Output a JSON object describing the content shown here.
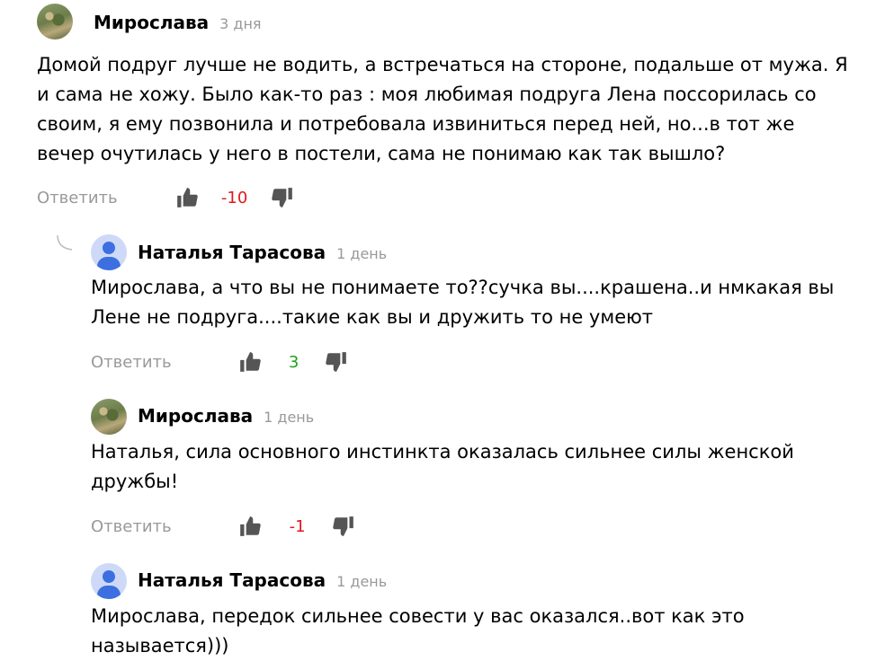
{
  "comments": [
    {
      "author": "Мирослава",
      "time": "3 дня",
      "text": "Домой подруг лучше не водить, а встречаться на стороне, подальше от мужа. Я и сама не хожу. Было как-то раз : моя любимая подруга Лена поссорилась со своим, я ему позвонила и потребовала извиниться перед ней, но...в тот же вечер очутилась у него в постели, сама не понимаю как так вышло?",
      "reply_label": "Ответить",
      "score": "-10",
      "avatar": "photo-avatar"
    },
    {
      "author": "Наталья Тарасова",
      "time": "1 день",
      "text": "Мирослава, а что вы не понимаете то??сучка вы....крашена..и нмкакая вы Лене не подруга....такие как вы и дружить то не умеют",
      "reply_label": "Ответить",
      "score": "3",
      "avatar": "default-user-avatar"
    },
    {
      "author": "Мирослава",
      "time": "1 день",
      "text": "Наталья, сила основного инстинкта оказалась сильнее силы женской дружбы!",
      "reply_label": "Ответить",
      "score": "-1",
      "avatar": "photo-avatar"
    },
    {
      "author": "Наталья Тарасова",
      "time": "1 день",
      "text": "Мирослава, передок сильнее совести у вас оказался..вот как это называется)))",
      "avatar": "default-user-avatar"
    }
  ],
  "colors": {
    "negative_score": "#e0181e",
    "positive_score": "#1ba21b",
    "muted": "#999999",
    "avatar_default_bg": "#cdd9f7",
    "avatar_default_fg": "#3d6fe0"
  },
  "icons": {
    "like": "thumbs-up-icon",
    "dislike": "thumbs-down-icon",
    "thread": "reply-thread-icon"
  }
}
